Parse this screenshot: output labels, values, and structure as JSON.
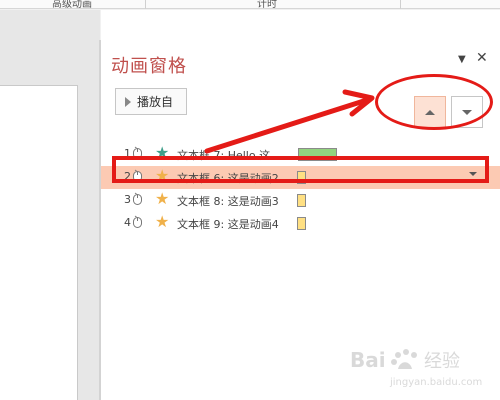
{
  "ribbon": {
    "tab_left": "高级动画",
    "tab_mid": "计时"
  },
  "pane": {
    "title": "动画窗格",
    "play_label": "播放自",
    "menu_icon": "chevron-down-icon",
    "close_icon": "close-icon"
  },
  "animations": [
    {
      "num": "1",
      "label": "文本框 7: Hello,这...",
      "star_color": "#3f9f8a",
      "bar_color": "#92d37f",
      "bar_kind": "wide",
      "selected": false
    },
    {
      "num": "2",
      "label": "文本框 6: 这是动画2",
      "star_color": "#f0b14a",
      "bar_color": "#ffe083",
      "bar_kind": "narrow",
      "selected": true
    },
    {
      "num": "3",
      "label": "文本框 8: 这是动画3",
      "star_color": "#f0b14a",
      "bar_color": "#ffe083",
      "bar_kind": "narrow",
      "selected": false
    },
    {
      "num": "4",
      "label": "文本框 9: 这是动画4",
      "star_color": "#f0b14a",
      "bar_color": "#ffe083",
      "bar_kind": "narrow",
      "selected": false
    }
  ],
  "annotation_color": "#e41b17",
  "selected_row_color": "#fccab3",
  "watermark": {
    "text_cn": "经验",
    "text_en": "jingyan.baidu.com",
    "brand": "Bai"
  }
}
